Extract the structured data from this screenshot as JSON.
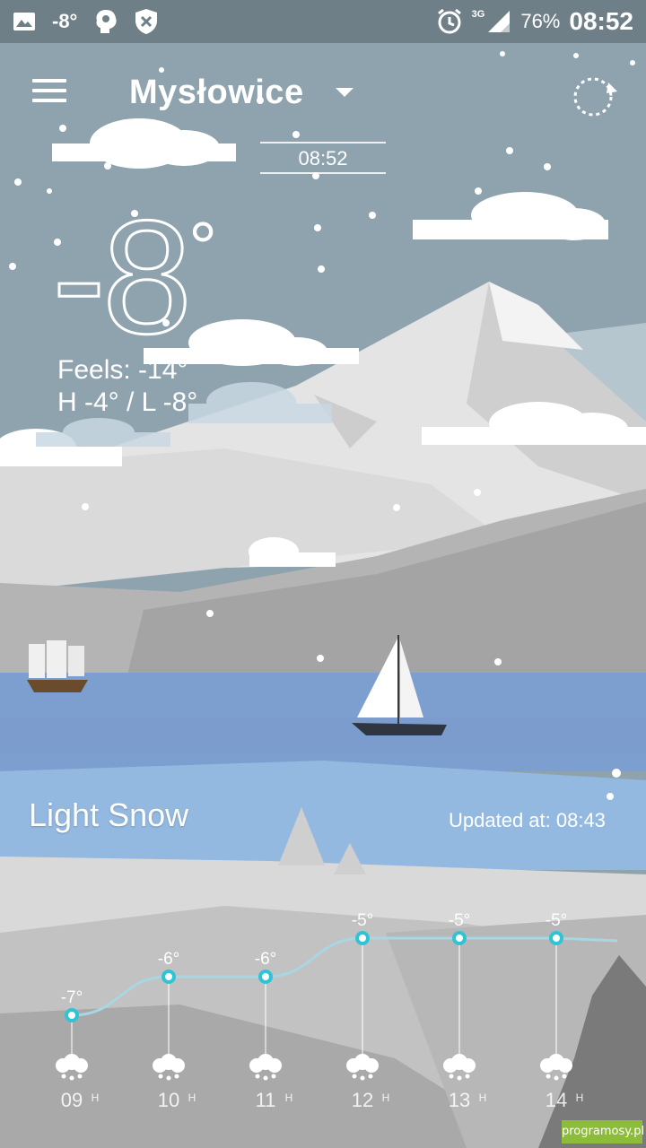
{
  "status_bar": {
    "temp": "-8°",
    "network": "3G",
    "battery": "76%",
    "time": "08:52",
    "icons": [
      "image-icon",
      "brain-icon",
      "shield-x-icon",
      "alarm-icon",
      "signal-icon"
    ]
  },
  "header": {
    "city": "Mysłowice",
    "clock": "08:52"
  },
  "current": {
    "temp": "-8",
    "degree_symbol": "°",
    "feels": "Feels: -14°",
    "hilo": "H -4° / L -8°",
    "condition": "Light Snow",
    "updated": "Updated at: 08:43"
  },
  "forecast": {
    "hours": [
      {
        "hour": "09",
        "unit": "H",
        "temp": "-7°",
        "value": -7
      },
      {
        "hour": "10",
        "unit": "H",
        "temp": "-6°",
        "value": -6
      },
      {
        "hour": "11",
        "unit": "H",
        "temp": "-6°",
        "value": -6
      },
      {
        "hour": "12",
        "unit": "H",
        "temp": "-5°",
        "value": -5
      },
      {
        "hour": "13",
        "unit": "H",
        "temp": "-5°",
        "value": -5
      },
      {
        "hour": "14",
        "unit": "H",
        "temp": "-5°",
        "value": -5
      }
    ],
    "icon": "snow-icon",
    "line_color": "#a9d6e3",
    "dot_color": "#2ec4d6"
  },
  "watermark": "programosy.pl",
  "colors": {
    "sky": "#8fa3ae",
    "lake": "#7d9fd0",
    "mountain": "#e6e6e6"
  }
}
